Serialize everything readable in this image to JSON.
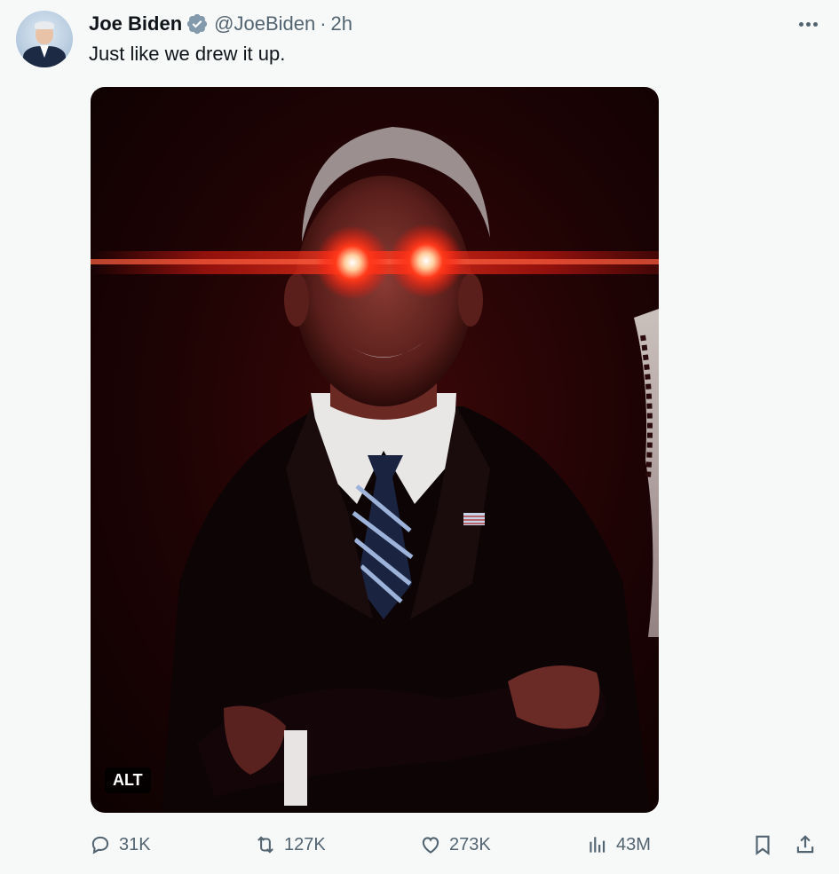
{
  "tweet": {
    "author_name": "Joe Biden",
    "handle": "@JoeBiden",
    "separator": "·",
    "time": "2h",
    "text": "Just like we drew it up.",
    "verified_color": "#829aab"
  },
  "media": {
    "alt_badge": "ALT"
  },
  "actions": {
    "replies": "31K",
    "reposts": "127K",
    "likes": "273K",
    "views": "43M"
  },
  "icons": [
    "more-icon",
    "verified-badge-icon",
    "reply-icon",
    "repost-icon",
    "like-icon",
    "views-icon",
    "bookmark-icon",
    "share-icon"
  ],
  "colors": {
    "background": "#f7f9f9",
    "text": "#0f1419",
    "secondary_text": "#536471",
    "laser_red": "#ff2a1a"
  }
}
